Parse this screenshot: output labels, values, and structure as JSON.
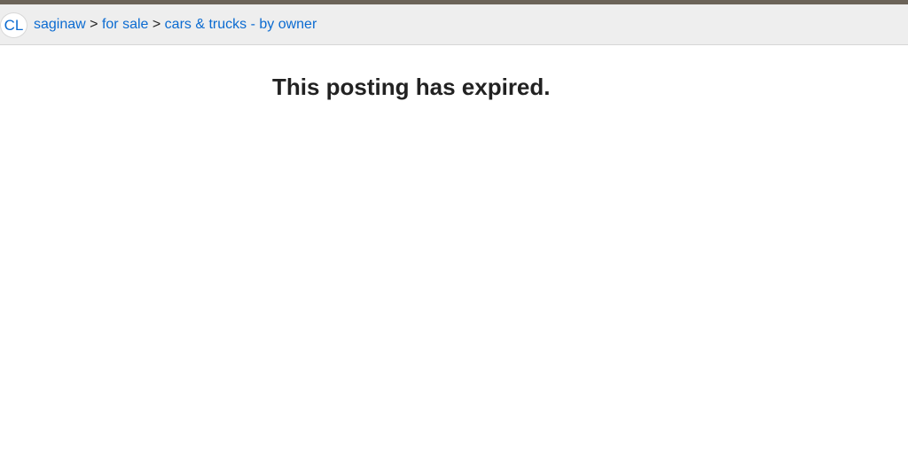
{
  "header": {
    "logo_text": "CL",
    "breadcrumb": {
      "area": "saginaw",
      "section": "for sale",
      "category": "cars & trucks - by owner",
      "separator": ">"
    }
  },
  "main": {
    "message": "This posting has expired."
  },
  "colors": {
    "link": "#0b6bd1",
    "bar_background": "#eeeeee",
    "top_strip": "#6b6358",
    "text": "#222222"
  }
}
